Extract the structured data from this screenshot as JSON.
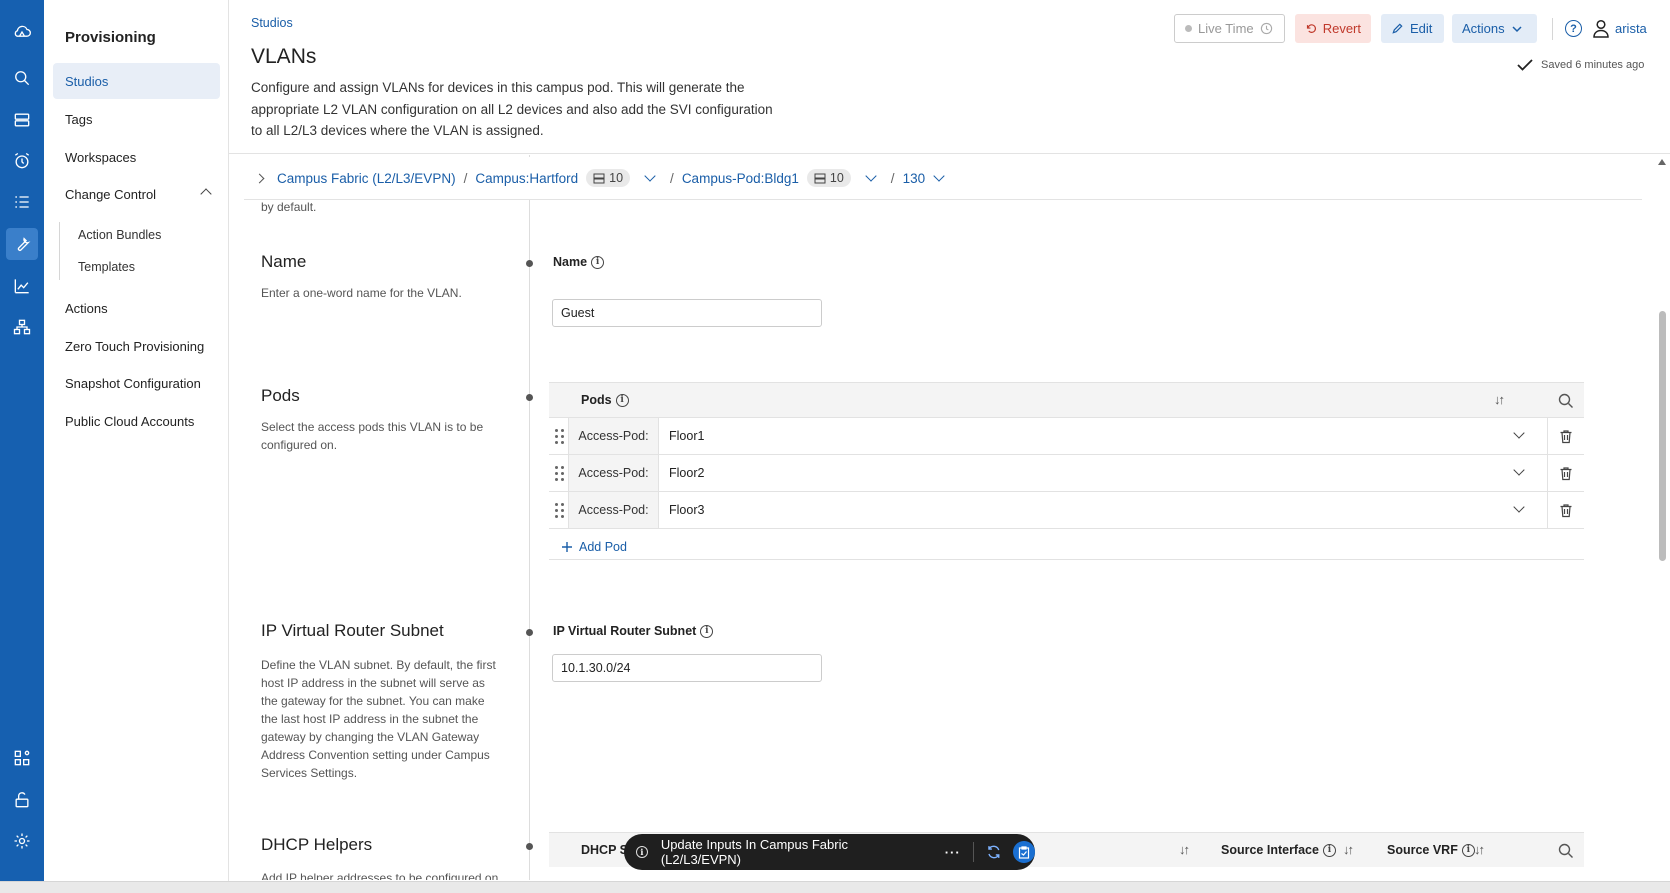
{
  "nav": {
    "title": "Provisioning",
    "items": [
      {
        "label": "Studios"
      },
      {
        "label": "Tags"
      },
      {
        "label": "Workspaces"
      },
      {
        "label": "Change Control"
      },
      {
        "label": "Action Bundles"
      },
      {
        "label": "Templates"
      },
      {
        "label": "Actions"
      },
      {
        "label": "Zero Touch Provisioning"
      },
      {
        "label": "Snapshot Configuration"
      },
      {
        "label": "Public Cloud Accounts"
      }
    ]
  },
  "header": {
    "breadcrumb": "Studios",
    "title": "VLANs",
    "description": "Configure and assign VLANs for devices in this campus pod. This will generate the appropriate L2 VLAN configuration on all L2 devices and also add the SVI configuration to all L2/L3 devices where the VLAN is assigned.",
    "live_time": "Live Time",
    "revert": "Revert",
    "edit": "Edit",
    "actions": "Actions",
    "user": "arista",
    "saved": "Saved 6 minutes ago"
  },
  "fabric_bar": {
    "fabric": "Campus Fabric (L2/L3/EVPN)",
    "campus": "Campus:Hartford",
    "campus_count": "10",
    "pod": "Campus-Pod:Bldg1",
    "pod_count": "10",
    "vlan": "130"
  },
  "form": {
    "top_fragment": "by default.",
    "name": {
      "title": "Name",
      "desc": "Enter a one-word name for the VLAN.",
      "label": "Name",
      "value": "Guest"
    },
    "pods": {
      "title": "Pods",
      "desc": "Select the access pods this VLAN is to be configured on.",
      "column": "Pods",
      "key": "Access-Pod:",
      "rows": [
        {
          "value": "Floor1"
        },
        {
          "value": "Floor2"
        },
        {
          "value": "Floor3"
        }
      ],
      "add_label": "Add Pod"
    },
    "subnet": {
      "title": "IP Virtual Router Subnet",
      "desc": "Define the VLAN subnet. By default, the first host IP address in the subnet will serve as the gateway for the subnet. You can make the last host IP address in the subnet the gateway by changing the VLAN Gateway Address Convention setting under Campus Services Settings.",
      "label": "IP Virtual Router Subnet",
      "value": "10.1.30.0/24"
    },
    "dhcp": {
      "title": "DHCP Helpers",
      "desc": "Add IP helper addresses to be configured on",
      "col1": "DHCP S",
      "col2": "Source Interface",
      "col3": "Source VRF"
    }
  },
  "toast": {
    "message": "Update Inputs In Campus Fabric (L2/L3/EVPN)",
    "more": "···"
  }
}
